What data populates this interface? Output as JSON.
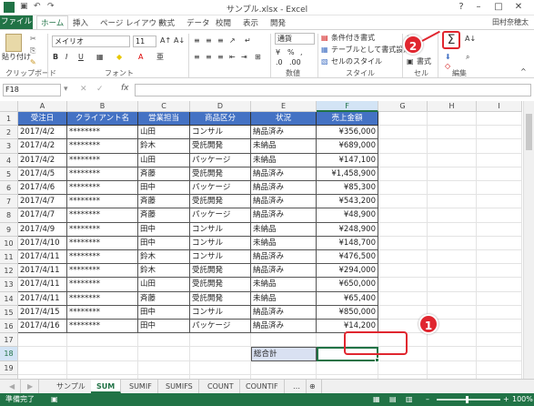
{
  "titlebar": {
    "title": "サンプル.xlsx - Excel",
    "user": "田村奈穂太"
  },
  "tabs": [
    "ファイル",
    "ホーム",
    "挿入",
    "ページ レイアウト",
    "数式",
    "データ",
    "校閲",
    "表示",
    "開発"
  ],
  "ribbon": {
    "paste": "貼り付け",
    "clipboard": "クリップボード",
    "font_name": "メイリオ",
    "font_size": "11",
    "font_group": "フォント",
    "number_format": "通貨",
    "number_group": "数値",
    "cond_format": "条件付き書式",
    "table_format": "テーブルとして書式設定",
    "cell_style": "セルのスタイル",
    "style_group": "スタイル",
    "cell_group": "セル",
    "edit_group": "編集",
    "format_btn": "書式",
    "sigma": "Σ"
  },
  "formula_bar": {
    "name_box": "F18",
    "fx": "fx",
    "value": ""
  },
  "columns": [
    "A",
    "B",
    "C",
    "D",
    "E",
    "F",
    "G",
    "H",
    "I"
  ],
  "headers": [
    "受注日",
    "クライアント名",
    "営業担当",
    "商品区分",
    "状況",
    "売上金額"
  ],
  "rows": [
    [
      "2017/4/2",
      "********",
      "山田",
      "コンサル",
      "納品済み",
      "¥356,000"
    ],
    [
      "2017/4/2",
      "********",
      "鈴木",
      "受託開発",
      "未納品",
      "¥689,000"
    ],
    [
      "2017/4/2",
      "********",
      "山田",
      "パッケージ",
      "未納品",
      "¥147,100"
    ],
    [
      "2017/4/5",
      "********",
      "斉藤",
      "受託開発",
      "納品済み",
      "¥1,458,900"
    ],
    [
      "2017/4/6",
      "********",
      "田中",
      "パッケージ",
      "納品済み",
      "¥85,300"
    ],
    [
      "2017/4/7",
      "********",
      "斉藤",
      "受託開発",
      "納品済み",
      "¥543,200"
    ],
    [
      "2017/4/7",
      "********",
      "斉藤",
      "パッケージ",
      "納品済み",
      "¥48,900"
    ],
    [
      "2017/4/9",
      "********",
      "田中",
      "コンサル",
      "未納品",
      "¥248,900"
    ],
    [
      "2017/4/10",
      "********",
      "田中",
      "コンサル",
      "未納品",
      "¥148,700"
    ],
    [
      "2017/4/11",
      "********",
      "鈴木",
      "コンサル",
      "納品済み",
      "¥476,500"
    ],
    [
      "2017/4/11",
      "********",
      "鈴木",
      "受託開発",
      "納品済み",
      "¥294,000"
    ],
    [
      "2017/4/11",
      "********",
      "山田",
      "受託開発",
      "未納品",
      "¥650,000"
    ],
    [
      "2017/4/11",
      "********",
      "斉藤",
      "受託開発",
      "未納品",
      "¥65,400"
    ],
    [
      "2017/4/15",
      "********",
      "田中",
      "コンサル",
      "納品済み",
      "¥850,000"
    ],
    [
      "2017/4/16",
      "********",
      "田中",
      "パッケージ",
      "納品済み",
      "¥14,200"
    ]
  ],
  "total_label": "総合計",
  "row_numbers": [
    "1",
    "2",
    "3",
    "4",
    "5",
    "6",
    "7",
    "8",
    "9",
    "10",
    "11",
    "12",
    "13",
    "14",
    "15",
    "16",
    "17",
    "18",
    "19",
    "20"
  ],
  "sheets": [
    "サンプル",
    "SUM",
    "SUMIF",
    "SUMIFS",
    "COUNT",
    "COUNTIF"
  ],
  "active_sheet": "SUM",
  "status": {
    "ready": "準備完了",
    "zoom": "100%"
  },
  "callouts": [
    "1",
    "2"
  ],
  "colors": {
    "excel_green": "#217346",
    "header_blue": "#4472c4",
    "callout_red": "#e0262f"
  }
}
